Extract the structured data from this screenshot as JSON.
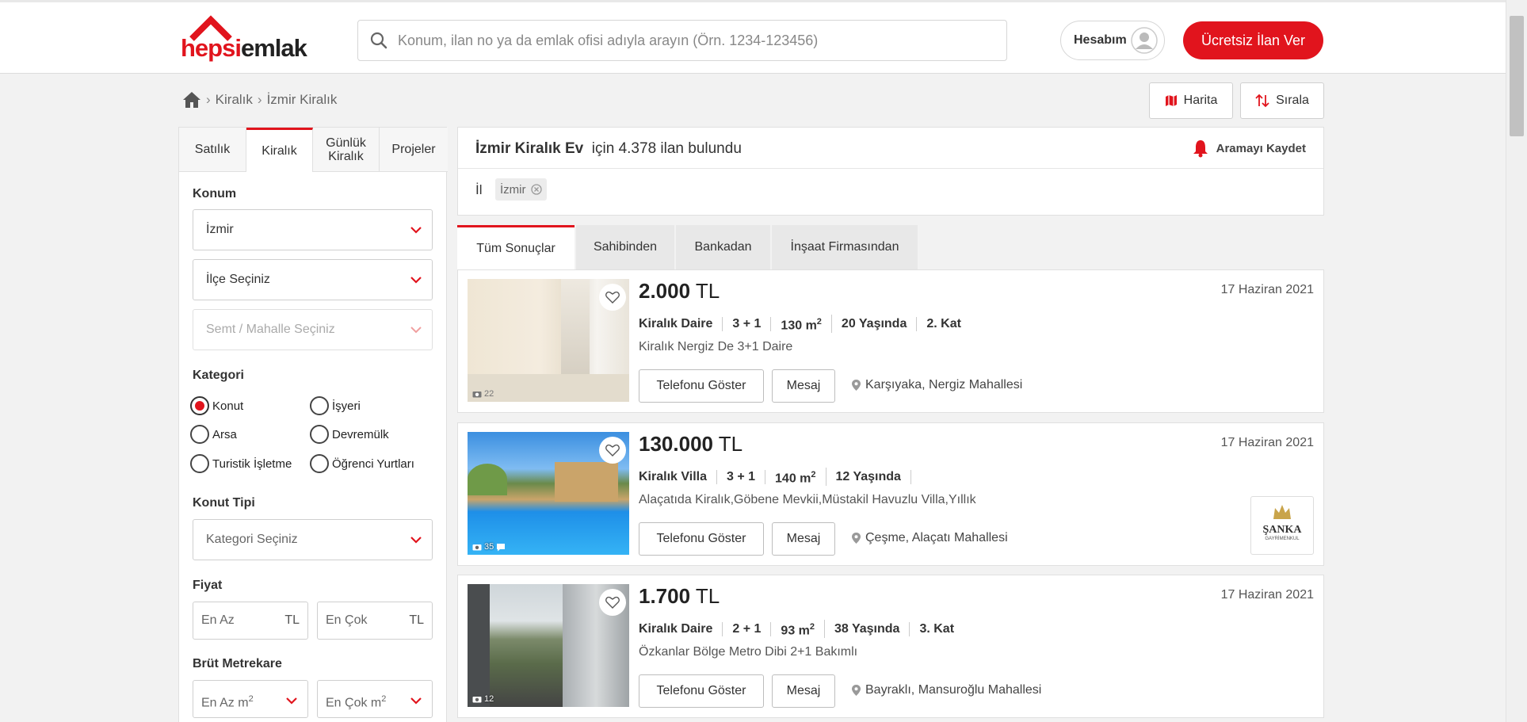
{
  "header": {
    "logo_text": "hepsiemlak",
    "search_placeholder": "Konum, ilan no ya da emlak ofisi adıyla arayın (Örn. 1234-123456)",
    "account_label": "Hesabım",
    "post_ad_label": "Ücretsiz İlan Ver",
    "brand_color": "#e1141d"
  },
  "breadcrumb": {
    "items": [
      "Kiralık",
      "İzmir Kiralık"
    ]
  },
  "toolbar": {
    "map_label": "Harita",
    "sort_label": "Sırala"
  },
  "sidebar": {
    "tabs": [
      "Satılık",
      "Kiralık",
      "Günlük Kiralık",
      "Projeler"
    ],
    "active_tab": "Kiralık",
    "location_label": "Konum",
    "city_value": "İzmir",
    "district_placeholder": "İlçe Seçiniz",
    "neighborhood_placeholder": "Semt / Mahalle Seçiniz",
    "category_label": "Kategori",
    "categories": [
      "Konut",
      "İşyeri",
      "Arsa",
      "Devremülk",
      "Turistik İşletme",
      "Öğrenci Yurtları"
    ],
    "selected_category": "Konut",
    "housing_type_label": "Konut Tipi",
    "housing_type_placeholder": "Kategori Seçiniz",
    "price_label": "Fiyat",
    "price_min_placeholder": "En Az",
    "price_max_placeholder": "En Çok",
    "currency": "TL",
    "area_label": "Brüt Metrekare",
    "area_min_placeholder": "En Az m",
    "area_max_placeholder": "En Çok m",
    "area_unit_sup": "2"
  },
  "results": {
    "query": "İzmir Kiralık Ev",
    "count_text": "için 4.378 ilan bulundu",
    "save_search_label": "Aramayı Kaydet",
    "filter_label": "İl",
    "filter_chip": "İzmir",
    "tabs": [
      "Tüm Sonuçlar",
      "Sahibinden",
      "Bankadan",
      "İnşaat Firmasından"
    ],
    "active_tab": "Tüm Sonuçlar"
  },
  "listings": [
    {
      "price": "2.000",
      "currency": "TL",
      "date": "17 Haziran 2021",
      "type": "Kiralık Daire",
      "rooms": "3 + 1",
      "area": "130 m",
      "area_sup": "2",
      "age": "20 Yaşında",
      "floor": "2. Kat",
      "title": "Kiralık Nergiz De 3+1 Daire",
      "phone_label": "Telefonu Göster",
      "message_label": "Mesaj",
      "location": "Karşıyaka, Nergiz Mahallesi",
      "photo_count": "22"
    },
    {
      "price": "130.000",
      "currency": "TL",
      "date": "17 Haziran 2021",
      "type": "Kiralık Villa",
      "rooms": "3 + 1",
      "area": "140 m",
      "area_sup": "2",
      "age": "12 Yaşında",
      "floor": "",
      "title": "Alaçatıda Kiralık,Göbene Mevkii,Müstakil Havuzlu Villa,Yıllık",
      "phone_label": "Telefonu Göster",
      "message_label": "Mesaj",
      "location": "Çeşme, Alaçatı Mahallesi",
      "photo_count": "35",
      "agency_logo_text": "ŞANKA",
      "agency_logo_sub": "GAYRİMENKUL"
    },
    {
      "price": "1.700",
      "currency": "TL",
      "date": "17 Haziran 2021",
      "type": "Kiralık Daire",
      "rooms": "2 + 1",
      "area": "93 m",
      "area_sup": "2",
      "age": "38 Yaşında",
      "floor": "3. Kat",
      "title": "Özkanlar Bölge Metro Dibi 2+1 Bakımlı",
      "phone_label": "Telefonu Göster",
      "message_label": "Mesaj",
      "location": "Bayraklı, Mansuroğlu Mahallesi",
      "photo_count": "12"
    }
  ]
}
